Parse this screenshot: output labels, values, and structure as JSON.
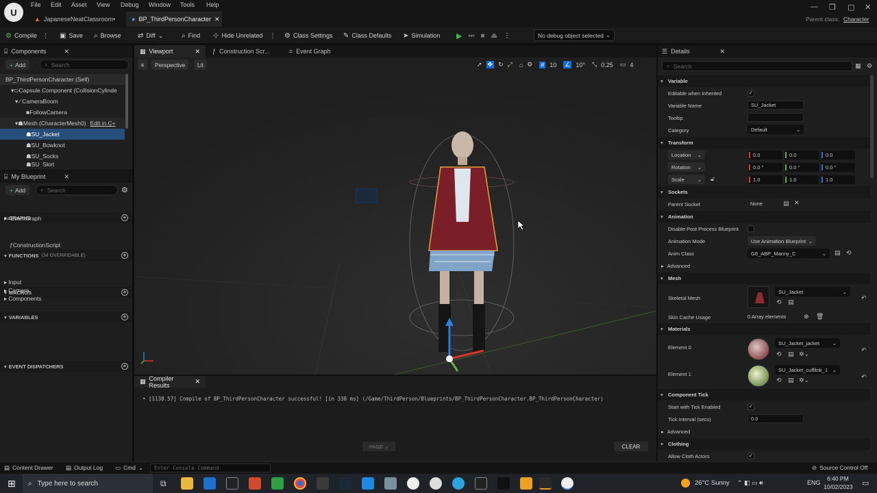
{
  "menu": [
    "File",
    "Edit",
    "Asset",
    "View",
    "Debug",
    "Window",
    "Tools",
    "Help"
  ],
  "tabs": [
    {
      "label": "JapaneseNeatClassroom•"
    },
    {
      "label": "BP_ThirdPersonCharacter"
    }
  ],
  "parent_class": {
    "label": "Parent class:",
    "value": "Character"
  },
  "toolbar": {
    "compile": "Compile",
    "save": "Save",
    "browse": "Browse",
    "diff": "Diff",
    "find": "Find",
    "hide_unrelated": "Hide Unrelated",
    "class_settings": "Class Settings",
    "class_defaults": "Class Defaults",
    "simulation": "Simulation",
    "debug_object": "No debug object selected"
  },
  "components": {
    "title": "Components",
    "add": "Add",
    "search_placeholder": "Search",
    "items": [
      "BP_ThirdPersonCharacter (Self)",
      "Capsule Component (CollisionCylinde",
      "CameraBoom",
      "FollowCamera",
      "Mesh (CharacterMesh0)",
      "SU_Jacket",
      "SU_Bowknot",
      "SU_Socks",
      "SU_Skirt"
    ],
    "edit_in_cpp": "Edit in C+"
  },
  "my_blueprint": {
    "title": "My Blueprint",
    "add": "Add",
    "search_placeholder": "Search",
    "graphs": "GRAPHS",
    "event_graph": "EventGraph",
    "functions": "FUNCTIONS",
    "functions_count": "(34 OVERRIDABLE)",
    "construction_script": "ConstructionScript",
    "macros": "MACROS",
    "variables": "VARIABLES",
    "var_groups": [
      "Input",
      "Camera",
      "Components"
    ],
    "event_dispatchers": "EVENT DISPATCHERS"
  },
  "editor_tabs": {
    "viewport": "Viewport",
    "construction": "Construction Scr...",
    "event_graph": "Event Graph"
  },
  "viewport": {
    "perspective": "Perspective",
    "lit": "Lit",
    "grid_snap": "10",
    "rot_snap": "10°",
    "scale_snap": "0.25",
    "cam_speed": "4"
  },
  "compiler": {
    "title": "Compiler Results",
    "message": "[1138.57] Compile of BP_ThirdPersonCharacter successful! [in 338 ms] (/Game/ThirdPerson/Blueprints/BP_ThirdPersonCharacter.BP_ThirdPersonCharacter)",
    "page": "PAGE",
    "clear": "CLEAR"
  },
  "details": {
    "title": "Details",
    "search_placeholder": "Search",
    "variable": "Variable",
    "editable_when_inherited": "Editable when Inherited",
    "variable_name_label": "Variable Name",
    "variable_name": "SU_Jacket",
    "tooltip": "Tooltip",
    "category": "Category",
    "category_value": "Default",
    "transform": "Transform",
    "location": "Location",
    "rotation": "Rotation",
    "scale": "Scale",
    "loc": [
      "0.0",
      "0.0",
      "0.0"
    ],
    "rot": [
      "0.0 °",
      "0.0 °",
      "0.0 °"
    ],
    "scl": [
      "1.0",
      "1.0",
      "1.0"
    ],
    "sockets": "Sockets",
    "parent_socket": "Parent Socket",
    "parent_socket_value": "None",
    "animation": "Animation",
    "disable_pp": "Disable Post Process Blueprint",
    "animation_mode": "Animation Mode",
    "animation_mode_value": "Use Animation Blueprint",
    "anim_class": "Anim Class",
    "anim_class_value": "G8_ABP_Manny_C",
    "advanced": "Advanced",
    "mesh": "Mesh",
    "skeletal_mesh": "Skeletal Mesh",
    "skeletal_mesh_value": "SU_Jacket",
    "skin_cache": "Skin Cache Usage",
    "skin_cache_value": "0 Array elements",
    "materials": "Materials",
    "element0": "Element 0",
    "element0_value": "SU_Jacket_jacket",
    "element1": "Element 1",
    "element1_value": "SU_Jacket_cufflink_1",
    "component_tick": "Component Tick",
    "start_tick": "Start with Tick Enabled",
    "tick_interval": "Tick Interval (secs)",
    "tick_interval_value": "0.0",
    "advanced2": "Advanced",
    "clothing": "Clothing",
    "allow_cloth": "Allow Cloth Actors"
  },
  "statusbar": {
    "content_drawer": "Content Drawer",
    "output_log": "Output Log",
    "cmd": "Cmd",
    "console_placeholder": "Enter Console Command",
    "source_control": "Source Control Off"
  },
  "taskbar": {
    "search_placeholder": "Type here to search",
    "weather": "26°C Sunny",
    "lang": "ENG",
    "time": "6:40 PM",
    "date": "10/02/2023"
  },
  "colors": {
    "accent": "#0f6fd7",
    "selection": "#264e7a",
    "play": "#3bb84a"
  }
}
